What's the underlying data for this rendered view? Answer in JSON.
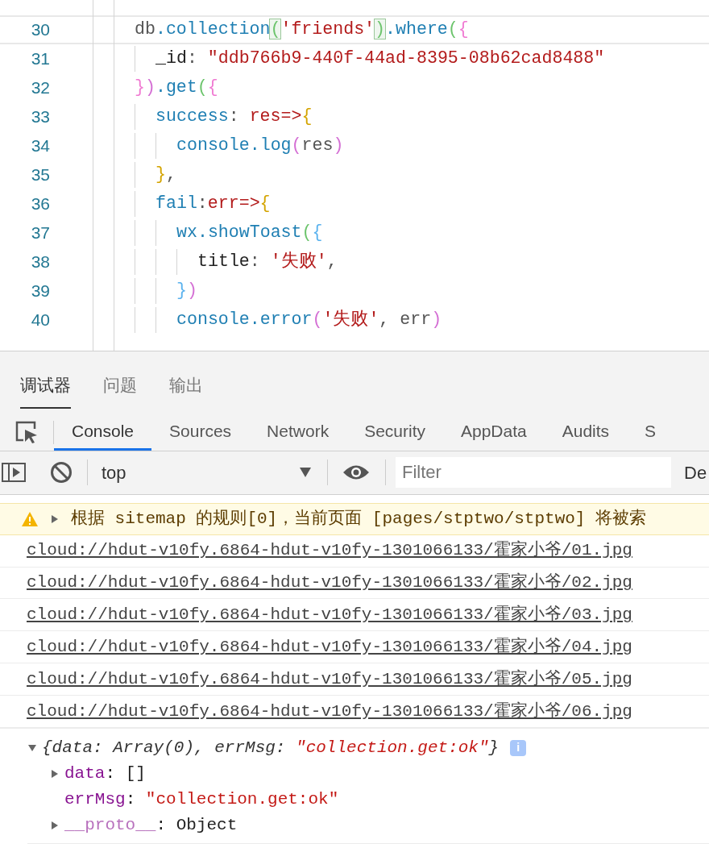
{
  "editor": {
    "lines": [
      {
        "number": "30",
        "current": true,
        "tokens": [
          {
            "text": "db",
            "kind": "plain"
          },
          {
            "text": ".collection",
            "kind": "call"
          },
          {
            "text": "(",
            "kind": "match"
          },
          {
            "text": "'friends'",
            "kind": "string"
          },
          {
            "text": ")",
            "kind": "match"
          },
          {
            "text": ".where",
            "kind": "call"
          },
          {
            "text": "(",
            "kind": "paren"
          },
          {
            "text": "{",
            "kind": "brace"
          }
        ],
        "children": [
          {
            "number": "31",
            "current": false,
            "tokens": [
              {
                "text": "_id",
                "kind": "dark"
              },
              {
                "text": ": ",
                "kind": "plain"
              },
              {
                "text": "\"ddb766b9-440f-44ad-8395-08b62cad8488\"",
                "kind": "string"
              }
            ]
          }
        ]
      },
      {
        "number": "32",
        "current": false,
        "tokens": [
          {
            "text": "}",
            "kind": "brace"
          },
          {
            "text": ")",
            "kind": "paren2"
          },
          {
            "text": ".get",
            "kind": "call"
          },
          {
            "text": "(",
            "kind": "paren"
          },
          {
            "text": "{",
            "kind": "brace"
          }
        ],
        "children": [
          {
            "number": "33",
            "current": false,
            "tokens": [
              {
                "text": "success",
                "kind": "call"
              },
              {
                "text": ": ",
                "kind": "plain"
              },
              {
                "text": "res=>",
                "kind": "param"
              },
              {
                "text": "{",
                "kind": "brace3"
              }
            ],
            "children": [
              {
                "number": "34",
                "current": false,
                "tokens": [
                  {
                    "text": "console.log",
                    "kind": "call"
                  },
                  {
                    "text": "(",
                    "kind": "paren2"
                  },
                  {
                    "text": "res",
                    "kind": "plain"
                  },
                  {
                    "text": ")",
                    "kind": "paren2"
                  }
                ]
              }
            ]
          },
          {
            "number": "35",
            "current": false,
            "tokens": [
              {
                "text": "}",
                "kind": "brace3"
              },
              {
                "text": ",",
                "kind": "plain"
              }
            ]
          },
          {
            "number": "36",
            "current": false,
            "tokens": [
              {
                "text": "fail",
                "kind": "call"
              },
              {
                "text": ":",
                "kind": "plain"
              },
              {
                "text": "err=>",
                "kind": "param"
              },
              {
                "text": "{",
                "kind": "brace3"
              }
            ],
            "children": [
              {
                "number": "37",
                "current": false,
                "tokens": [
                  {
                    "text": "wx.showToast",
                    "kind": "call"
                  },
                  {
                    "text": "(",
                    "kind": "paren"
                  },
                  {
                    "text": "{",
                    "kind": "brace4"
                  }
                ],
                "children": [
                  {
                    "number": "38",
                    "current": false,
                    "tokens": [
                      {
                        "text": "title",
                        "kind": "dark"
                      },
                      {
                        "text": ": ",
                        "kind": "plain"
                      },
                      {
                        "text": "'失败'",
                        "kind": "string"
                      },
                      {
                        "text": ",",
                        "kind": "plain"
                      }
                    ]
                  }
                ]
              },
              {
                "number": "39",
                "current": false,
                "tokens": [
                  {
                    "text": "}",
                    "kind": "brace4"
                  },
                  {
                    "text": ")",
                    "kind": "paren2"
                  }
                ]
              },
              {
                "number": "40",
                "current": false,
                "tokens": [
                  {
                    "text": "console.error",
                    "kind": "call"
                  },
                  {
                    "text": "(",
                    "kind": "paren2"
                  },
                  {
                    "text": "'失败'",
                    "kind": "string"
                  },
                  {
                    "text": ", err",
                    "kind": "plain"
                  },
                  {
                    "text": ")",
                    "kind": "paren2"
                  }
                ]
              }
            ]
          }
        ]
      }
    ]
  },
  "panel_tabs": [
    {
      "label": "调试器",
      "selected": true
    },
    {
      "label": "问题",
      "selected": false
    },
    {
      "label": "输出",
      "selected": false
    }
  ],
  "devtools_tabs": [
    {
      "label": "Console",
      "selected": true
    },
    {
      "label": "Sources",
      "selected": false
    },
    {
      "label": "Network",
      "selected": false
    },
    {
      "label": "Security",
      "selected": false
    },
    {
      "label": "AppData",
      "selected": false
    },
    {
      "label": "Audits",
      "selected": false
    },
    {
      "label": "S",
      "selected": false
    }
  ],
  "toolbar": {
    "context": "top",
    "filter": {
      "placeholder": "Filter"
    },
    "levels": "De"
  },
  "console": [
    {
      "kind": "warning",
      "expanded": false,
      "text": "根据 sitemap 的规则[0]，当前页面 [pages/stptwo/stptwo] 将被索"
    },
    {
      "kind": "link",
      "text": "cloud://hdut-v10fy.6864-hdut-v10fy-1301066133/霍家小爷/01.jpg"
    },
    {
      "kind": "link",
      "text": "cloud://hdut-v10fy.6864-hdut-v10fy-1301066133/霍家小爷/02.jpg"
    },
    {
      "kind": "link",
      "text": "cloud://hdut-v10fy.6864-hdut-v10fy-1301066133/霍家小爷/03.jpg"
    },
    {
      "kind": "link",
      "text": "cloud://hdut-v10fy.6864-hdut-v10fy-1301066133/霍家小爷/04.jpg"
    },
    {
      "kind": "link",
      "text": "cloud://hdut-v10fy.6864-hdut-v10fy-1301066133/霍家小爷/05.jpg"
    },
    {
      "kind": "link",
      "text": "cloud://hdut-v10fy.6864-hdut-v10fy-1301066133/霍家小爷/06.jpg"
    },
    {
      "kind": "object",
      "expanded": true,
      "summary": [
        {
          "text": "{data: Array(0), errMsg: ",
          "kind": "plain"
        },
        {
          "text": "\"collection.get:ok\"",
          "kind": "string"
        },
        {
          "text": "}",
          "kind": "plain"
        }
      ],
      "badge": "i",
      "properties": [
        {
          "key": "data",
          "value": ": []",
          "expandable": true,
          "expanded": false,
          "kind": "own"
        },
        {
          "key": "errMsg",
          "value": ": ",
          "string": "\"collection.get:ok\"",
          "expandable": false,
          "kind": "own"
        },
        {
          "key": "__proto__",
          "value": ": Object",
          "expandable": true,
          "expanded": false,
          "kind": "inherited"
        }
      ]
    }
  ]
}
